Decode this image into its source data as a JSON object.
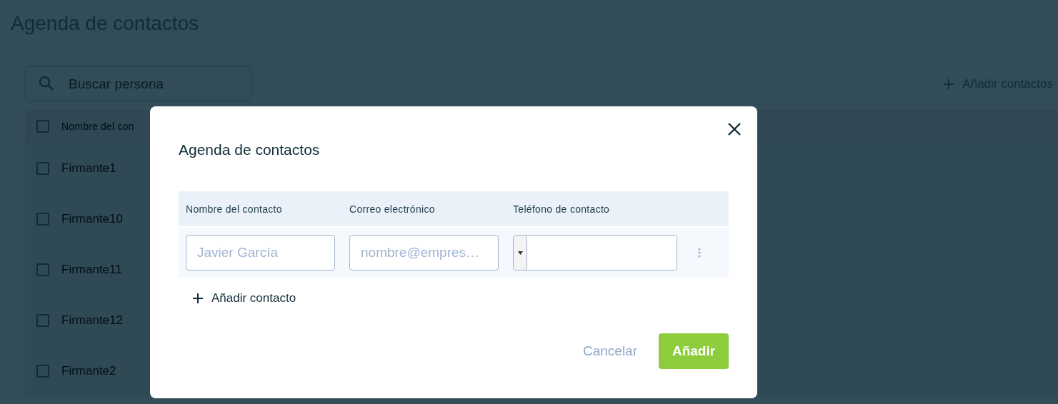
{
  "page": {
    "title": "Agenda de contactos",
    "search": {
      "placeholder": "Buscar persona"
    },
    "add_button": "Añadir contactos",
    "table": {
      "columns": [
        "Nombre del con"
      ],
      "header_checked": false,
      "rows": [
        {
          "name": "Firmante1",
          "checked": false
        },
        {
          "name": "Firmante10",
          "checked": false
        },
        {
          "name": "Firmante11",
          "checked": false
        },
        {
          "name": "Firmante12",
          "checked": false
        },
        {
          "name": "Firmante2",
          "checked": false
        }
      ]
    }
  },
  "dialog": {
    "title": "Agenda de contactos",
    "columns": [
      "Nombre del contacto",
      "Correo electrónico",
      "Teléfono de contacto"
    ],
    "rows": [
      {
        "name_placeholder": "Javier García",
        "email_placeholder": "nombre@empres…",
        "phone_value": ""
      }
    ],
    "add_row": "Añadir contacto",
    "cancel": "Cancelar",
    "submit": "Añadir"
  }
}
